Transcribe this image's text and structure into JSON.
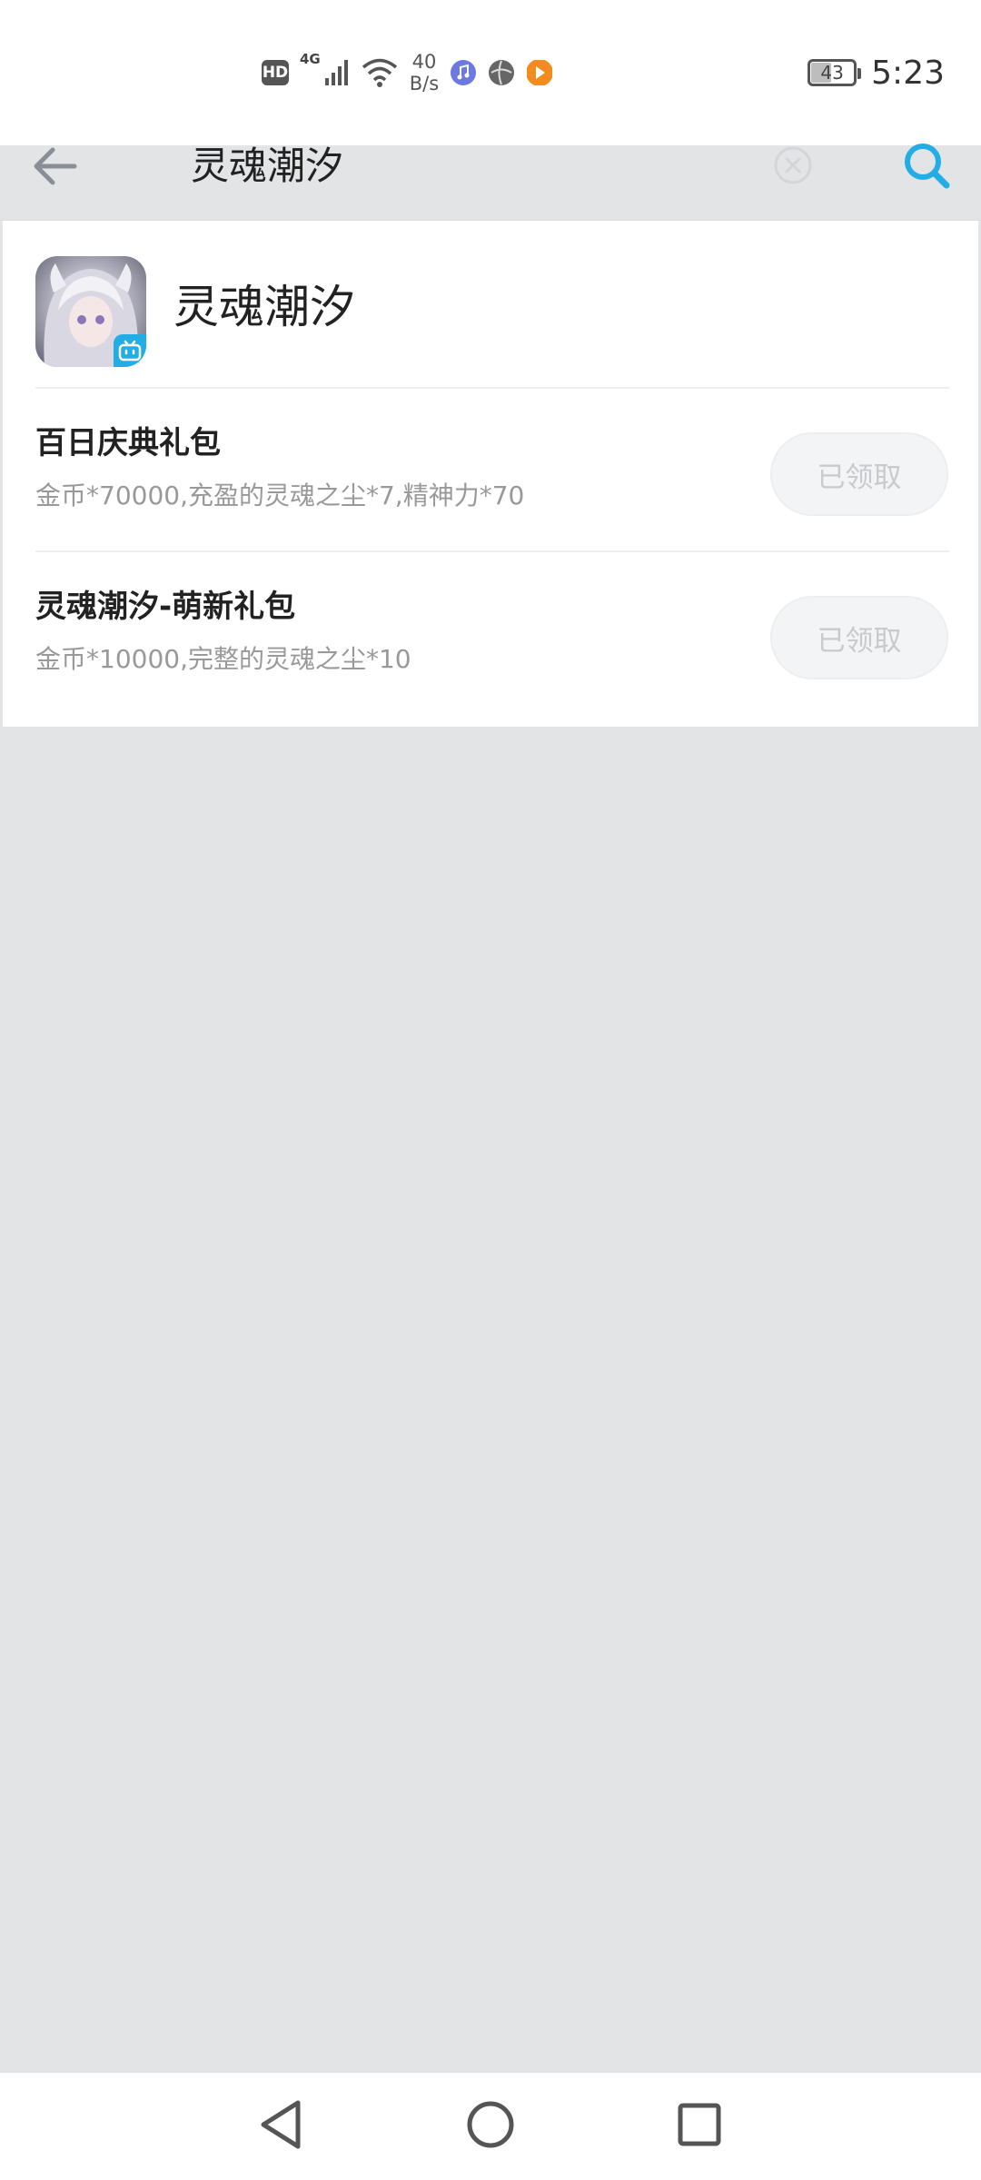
{
  "status_bar": {
    "hd_badge": "HD",
    "network": "4G",
    "speed_value": "40",
    "speed_unit": "B/s",
    "battery": "43",
    "time": "5:23"
  },
  "search": {
    "query": "灵魂潮汐"
  },
  "game": {
    "name": "灵魂潮汐"
  },
  "gifts": [
    {
      "title": "百日庆典礼包",
      "description": "金币*70000,充盈的灵魂之尘*7,精神力*70",
      "button_label": "已领取"
    },
    {
      "title": "灵魂潮汐-萌新礼包",
      "description": "金币*10000,完整的灵魂之尘*10",
      "button_label": "已领取"
    }
  ],
  "colors": {
    "accent": "#23ade5",
    "background": "#e3e4e6",
    "disabled_text": "#c9cacd"
  }
}
